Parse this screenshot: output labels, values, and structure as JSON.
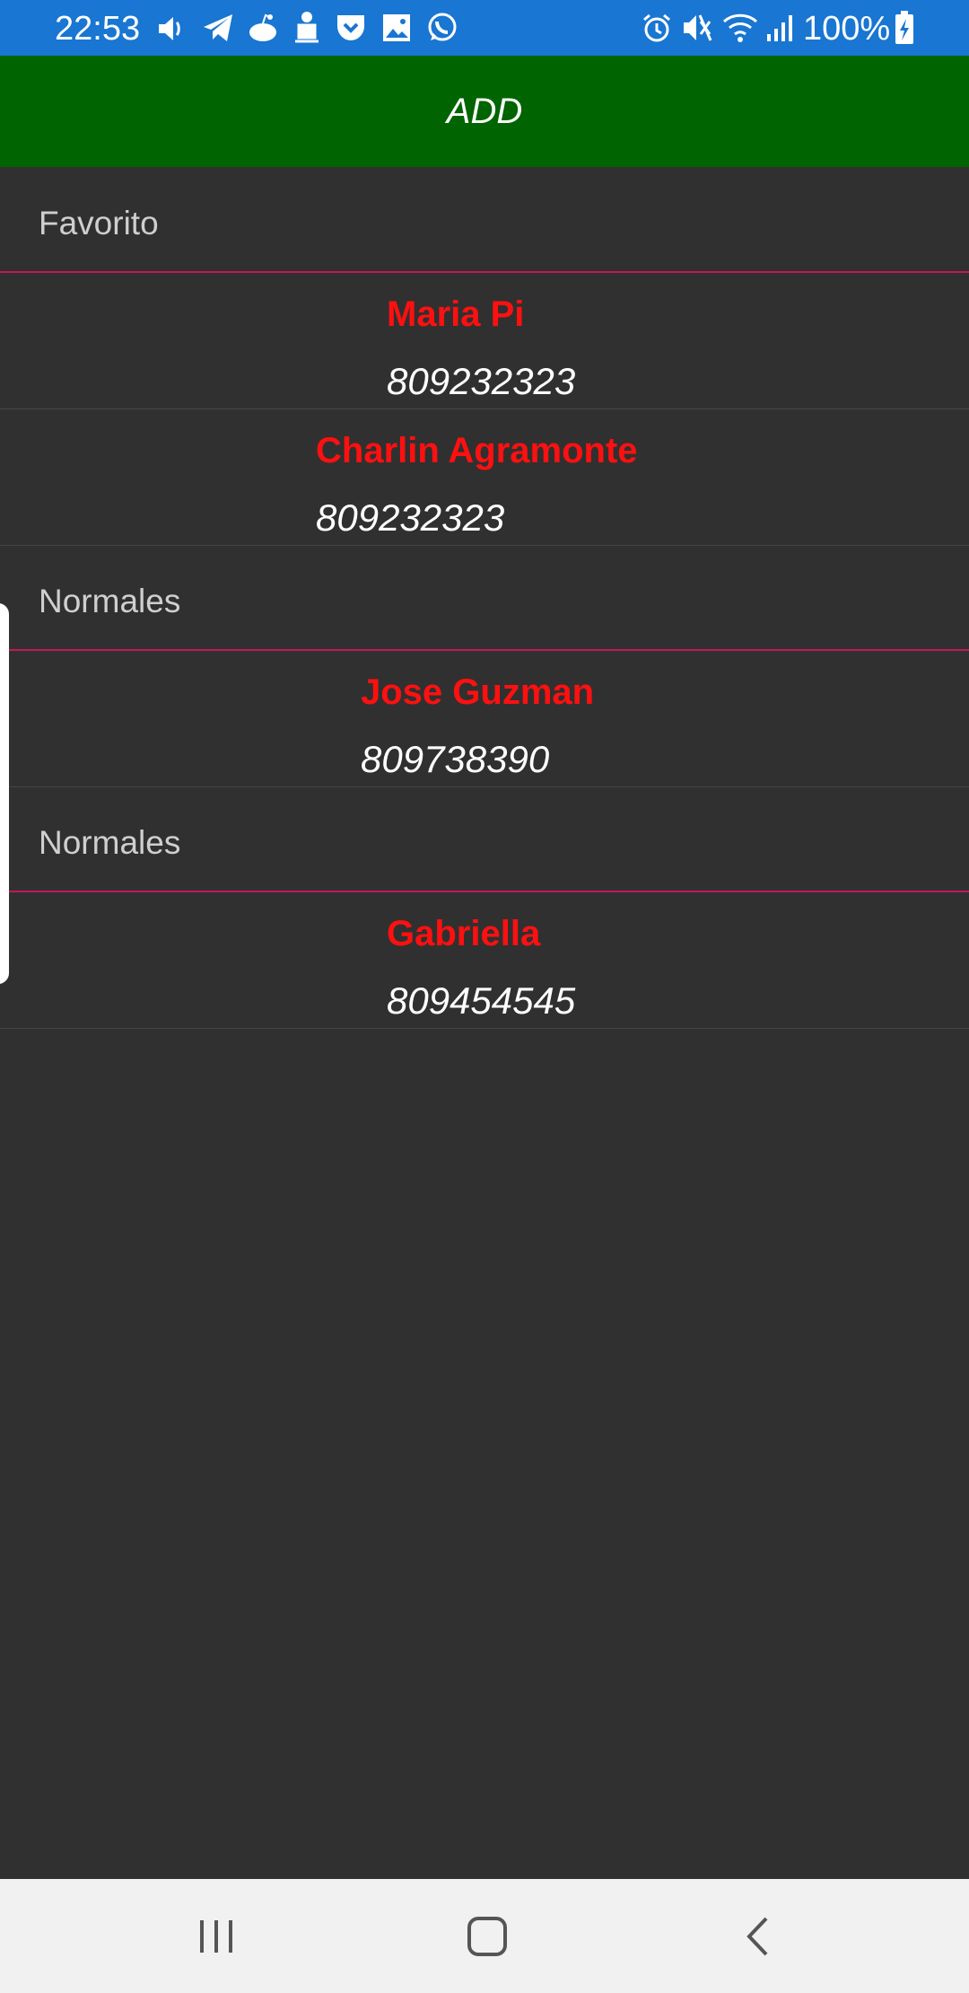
{
  "status_bar": {
    "time": "22:53",
    "battery": "100%",
    "left_icons": [
      "volume-icon",
      "telegram-icon",
      "reddit-icon",
      "android-icon",
      "pocket-icon",
      "gallery-icon",
      "whatsapp-icon"
    ],
    "right_icons": [
      "alarm-icon",
      "mute-icon",
      "wifi-icon",
      "signal-icon",
      "battery-icon"
    ]
  },
  "toolbar": {
    "add_label": "ADD"
  },
  "groups": [
    {
      "title": "Favorito",
      "contacts": [
        {
          "name": "Maria Pi",
          "phone": "809232323"
        },
        {
          "name": "Charlin Agramonte",
          "phone": "809232323"
        }
      ]
    },
    {
      "title": "Normales",
      "contacts": [
        {
          "name": "Jose Guzman",
          "phone": "809738390"
        }
      ]
    },
    {
      "title": "Normales",
      "contacts": [
        {
          "name": "Gabriella",
          "phone": "809454545"
        }
      ]
    }
  ],
  "nav_bar": {
    "icons": [
      "recent-apps-icon",
      "home-icon",
      "back-icon"
    ]
  },
  "colors": {
    "status_bar": "#1976d2",
    "add_bar": "#006400",
    "background": "#303030",
    "name_text": "#ff1010",
    "phone_text": "#ffffff",
    "separator": "#c2185b"
  }
}
